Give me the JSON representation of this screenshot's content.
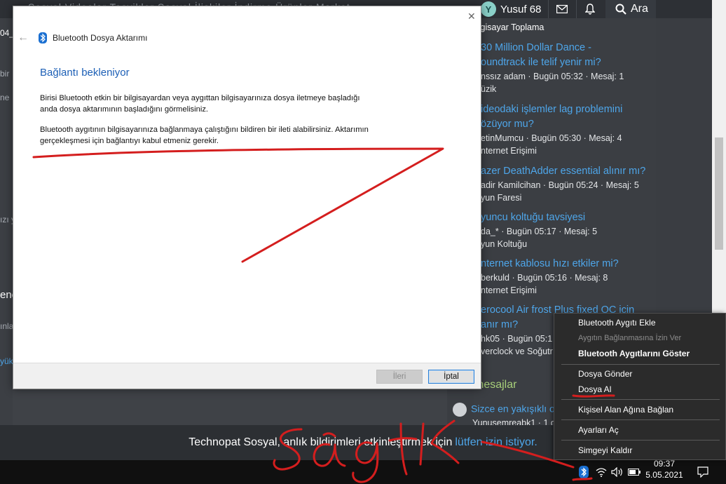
{
  "forum": {
    "nav_ghost": "Sosyal     Videolar     Teşvikler     Sosyal İlişkiler     İndirme     Ürünler     Market",
    "username": "Yusuf 68",
    "avatar_letter": "Y",
    "search_label": "Ara",
    "left_fragments": [
      "04_",
      "bir",
      "ne",
      "ızı y",
      "ene",
      "ınla",
      "yük"
    ],
    "sidebar_category_top": "ilgisayar Toplama",
    "threads": [
      {
        "title_lines": [
          "30 Million Dollar Dance -",
          "oundtrack ile telif yenir mi?"
        ],
        "meta": "nssız adam · Bugün 05:32 · Mesaj: 1",
        "forum": "üzik"
      },
      {
        "title_lines": [
          "ideodaki işlemler lag problemini",
          "özüyor mu?"
        ],
        "meta": "etinMumcu · Bugün 05:30 · Mesaj: 4",
        "forum": "nternet Erişimi"
      },
      {
        "title_lines": [
          "azer DeathAdder essential alınır mı?"
        ],
        "meta": "adir Kamilcihan · Bugün 05:24 · Mesaj: 5",
        "forum": "yun Faresi"
      },
      {
        "title_lines": [
          "yuncu koltuğu tavsiyesi"
        ],
        "meta": "da_* · Bugün 05:17 · Mesaj: 5",
        "forum": "yun Koltuğu"
      },
      {
        "title_lines": [
          "nternet kablosu hızı etkiler mi?"
        ],
        "meta": "berkuld · Bugün 05:16 · Mesaj: 8",
        "forum": "nternet Erişimi"
      },
      {
        "title_lines": [
          "erocool Air frost Plus fixed OC için",
          "anır mı?"
        ],
        "meta": "hk05 · Bugün 05:1",
        "forum": "verclock ve Soğutr"
      }
    ],
    "section2_title": "Yeni mesajlar",
    "section2_item": "Sizce en yakışıklı o",
    "section2_meta": "Yunusemreabk1 · 1 d",
    "notif_text": "Technopat Sosyal, anlık bildirimleri etkinleştirmek için",
    "notif_link": "lütfen izin istiyor."
  },
  "dialog": {
    "title": "Bluetooth Dosya Aktarımı",
    "heading": "Bağlantı bekleniyor",
    "para1_line1": "Birisi Bluetooth etkin bir bilgisayardan veya aygıttan bilgisayarınıza dosya iletmeye başladığı",
    "para1_line2": "anda dosya aktarımının başladığını görmelisiniz.",
    "para2_line1": "Bluetooth aygıtının bilgisayarınıza bağlanmaya çalıştığını bildiren bir ileti alabilirsiniz. Aktarımın",
    "para2_line2": "gerçekleşmesi için bağlantıyı kabul etmeniz gerekir.",
    "next_label": "İleri",
    "cancel_label": "İptal"
  },
  "context_menu": {
    "items": [
      {
        "label": "Bluetooth Aygıtı Ekle",
        "state": "normal"
      },
      {
        "label": "Aygıtın Bağlanmasına İzin Ver",
        "state": "disabled"
      },
      {
        "label": "Bluetooth Aygıtlarını Göster",
        "state": "bold"
      },
      {
        "label": "Dosya Gönder",
        "state": "normal"
      },
      {
        "label": "Dosya Al",
        "state": "normal"
      },
      {
        "label": "Kişisel Alan Ağına Bağlan",
        "state": "normal"
      },
      {
        "label": "Ayarları Aç",
        "state": "normal"
      },
      {
        "label": "Simgeyi Kaldır",
        "state": "normal"
      }
    ]
  },
  "taskbar": {
    "time": "09:37",
    "date": "5.05.2021"
  },
  "annotation": {
    "handwritten_text": "sağ tık",
    "ink_color": "#d41e1e"
  },
  "colors": {
    "link": "#4ea6ea",
    "dialog_heading": "#1c5fb6",
    "section_green": "#a8d07a"
  }
}
